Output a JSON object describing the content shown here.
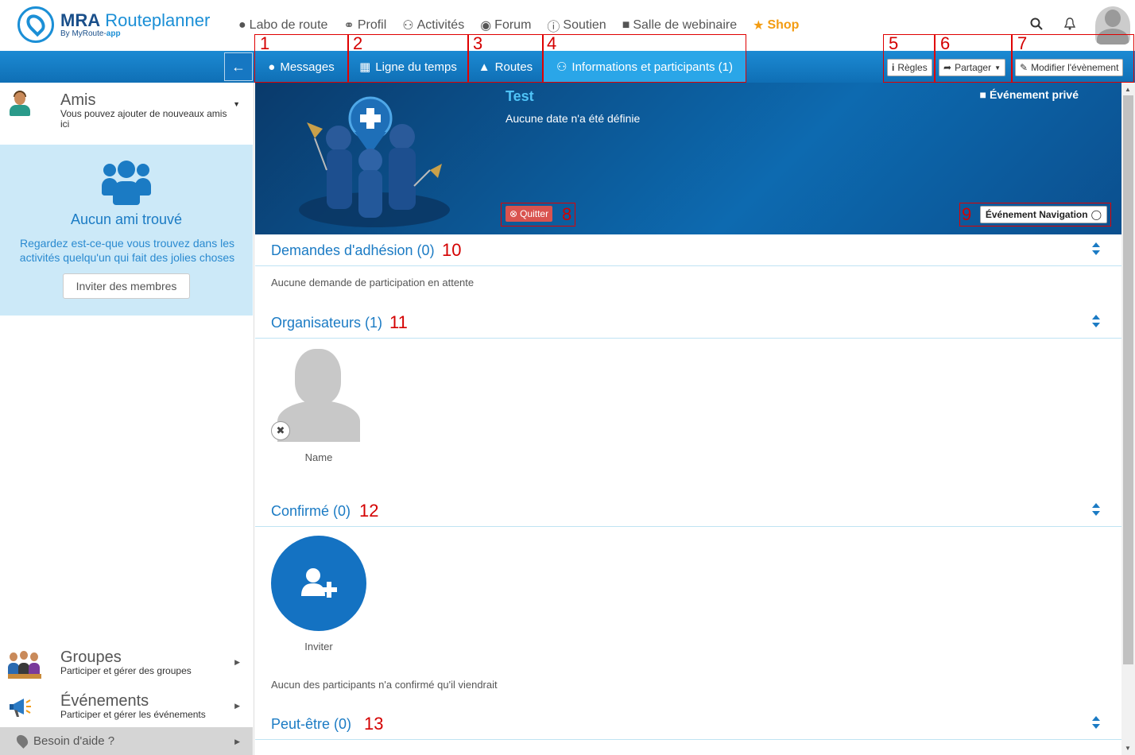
{
  "brand": {
    "title_bold": "MRA",
    "title_light": " Routeplanner",
    "sub_prefix": "By MyRoute-",
    "sub_bold": "app"
  },
  "menu": [
    {
      "label": "Labo de route",
      "icon": "map-marker-icon"
    },
    {
      "label": "Profil",
      "icon": "share-icon"
    },
    {
      "label": "Activités",
      "icon": "users-icon"
    },
    {
      "label": "Forum",
      "icon": "comments-icon"
    },
    {
      "label": "Soutien",
      "icon": "info-icon"
    },
    {
      "label": "Salle de webinaire",
      "icon": "video-camera-icon"
    },
    {
      "label": "Shop",
      "icon": "star-icon"
    }
  ],
  "tabs": [
    {
      "label": "Messages",
      "num": "1"
    },
    {
      "label": "Ligne du temps",
      "num": "2"
    },
    {
      "label": "Routes",
      "num": "3"
    },
    {
      "label": "Informations et participants (1)",
      "num": "4"
    }
  ],
  "toolbar": {
    "rules": {
      "label": "Règles",
      "num": "5"
    },
    "share": {
      "label": "Partager",
      "num": "6"
    },
    "edit": {
      "label": "Modifier l'évènement",
      "num": "7"
    }
  },
  "sidebar": {
    "friends": {
      "title": "Amis",
      "subtitle": "Vous pouvez ajouter de nouveaux amis ici"
    },
    "empty": {
      "title": "Aucun ami trouvé",
      "desc": "Regardez est-ce-que vous trouvez dans les activités quelqu'un qui fait des jolies choses",
      "button": "Inviter des membres"
    },
    "groups": {
      "title": "Groupes",
      "subtitle": "Participer et gérer des groupes"
    },
    "events": {
      "title": "Événements",
      "subtitle": "Participer et gérer les événements"
    },
    "help": "Besoin d'aide ?"
  },
  "event": {
    "title": "Test",
    "date": "Aucune date n'a été définie",
    "private": "Événement privé",
    "quit": {
      "label": "Quitter",
      "num": "8"
    },
    "navigation": {
      "label": "Événement Navigation",
      "num": "9"
    }
  },
  "sections": {
    "requests": {
      "title": "Demandes d'adhésion (0)",
      "num": "10",
      "text": "Aucune demande de participation en attente"
    },
    "organizers": {
      "title": "Organisateurs (1)",
      "num": "11",
      "person": "Name"
    },
    "confirmed": {
      "title": "Confirmé (0)",
      "num": "12",
      "invite": "Inviter",
      "text": "Aucun des participants n'a confirmé qu'il viendrait"
    },
    "maybe": {
      "title": "Peut-être (0)",
      "num": "13"
    }
  },
  "colors": {
    "primary": "#1b7bc4",
    "bar": "#1c8ad3",
    "active_tab": "#2aa6e8",
    "annotation": "#e00000",
    "shop": "#f39c12",
    "danger": "#d9534f"
  }
}
